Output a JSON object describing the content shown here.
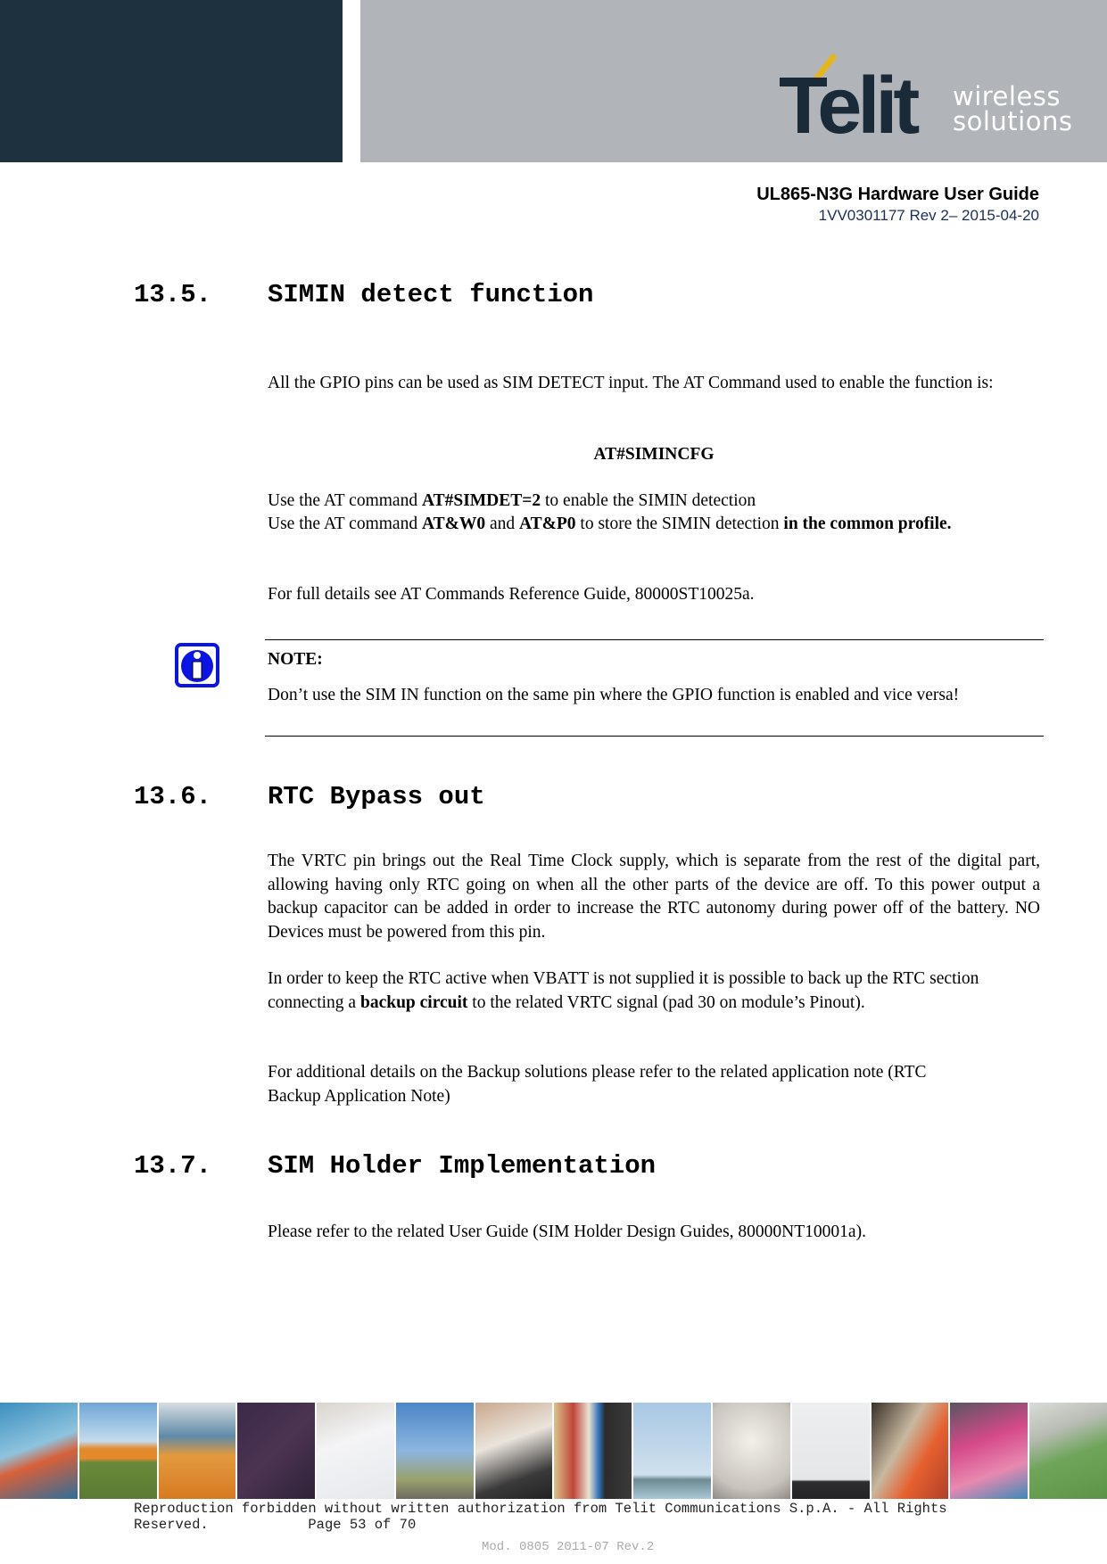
{
  "header": {
    "logo_text": "Telit",
    "logo_tagline_1": "wireless",
    "logo_tagline_2": "solutions",
    "doc_title": "UL865-N3G Hardware User Guide",
    "doc_revision": "1VV0301177 Rev 2– 2015-04-20",
    "colors": {
      "dark_panel": "#1e313f",
      "grey_panel": "#b1b5b9",
      "logo_accent": "#e5b61c"
    }
  },
  "sections": [
    {
      "number": "13.5.",
      "title": "SIMIN detect function",
      "paragraphs": {
        "p1": "All the GPIO pins can be used as SIM DETECT input. The AT Command used to enable the function is:",
        "command": "AT#SIMINCFG",
        "p2_pre": "Use the AT command ",
        "p2_bold": "AT#SIMDET=2",
        "p2_post": " to enable the SIMIN detection",
        "p3_pre": "Use the AT command ",
        "p3_bold1": "AT&W0",
        "p3_mid": " and ",
        "p3_bold2": "AT&P0",
        "p3_post": " to store the SIMIN detection ",
        "p3_bold3": "in the common profile.",
        "p4": "For full details see AT Commands Reference Guide, 80000ST10025a."
      },
      "note": {
        "icon": "info-icon",
        "title": "NOTE:",
        "text": "Don’t use the SIM IN function on the same pin where the GPIO function is enabled and vice versa!"
      }
    },
    {
      "number": "13.6.",
      "title": "RTC Bypass out",
      "paragraphs": {
        "p1": "The VRTC pin brings out the Real Time Clock supply, which is separate from the rest of the digital part, allowing having only RTC going on when all the other parts of the device are off. To this power output a backup capacitor can be added in order to increase the RTC autonomy during power off of the battery. NO Devices must be powered from this pin.",
        "p2_pre": "In order to keep the RTC active when VBATT is not supplied it is possible to back up the RTC section connecting a ",
        "p2_bold": "backup circuit",
        "p2_post": " to the related VRTC signal (pad 30 on module’s Pinout).",
        "p3": "For additional details on the Backup solutions please refer to the related application note (RTC Backup Application Note)"
      }
    },
    {
      "number": "13.7.",
      "title": "SIM Holder Implementation",
      "paragraphs": {
        "p1": "Please refer to the related User Guide (SIM Holder Design Guides, 80000NT10001a)."
      }
    }
  ],
  "footer": {
    "images": [
      "traffic-tunnel",
      "sos-phone",
      "freight-containers",
      "departure-board",
      "laptop-keyboard",
      "cyclist",
      "card-reader",
      "vending-machine",
      "wind-turbines",
      "kilowatt-meter",
      "building-facade",
      "train-platform",
      "printing-press",
      "security-camera"
    ],
    "copyright": "Reproduction forbidden without written authorization from Telit Communications S.p.A. - All Rights Reserved.",
    "page_label": "Page 53 of 70",
    "mod_label": "Mod. 0805 2011-07 Rev.2"
  }
}
